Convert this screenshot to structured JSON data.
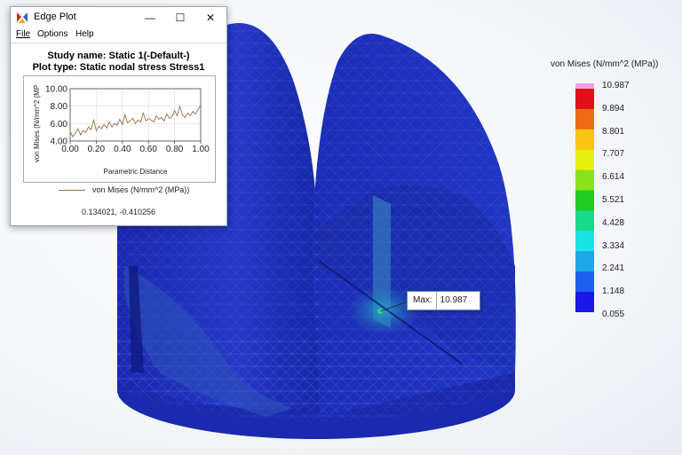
{
  "window": {
    "title": "Edge Plot",
    "minimize_glyph": "—",
    "maximize_glyph": "☐",
    "close_glyph": "✕",
    "icon": "solidworks-app-icon"
  },
  "menu": [
    {
      "label": "File"
    },
    {
      "label": "Options"
    },
    {
      "label": "Help"
    }
  ],
  "plot": {
    "study_name": "Study name: Static 1(-Default-)",
    "plot_type": "Plot type: Static nodal stress Stress1",
    "legend_label": "von Mises (N/mm^2 (MPa))",
    "coordinates": "0.134021, -0.410256",
    "line_color": "#9a6f4a"
  },
  "chart_data": {
    "type": "line",
    "xlabel": "Parametric Distance",
    "ylabel": "von Mises (N/mm^2 (MP",
    "xlim": [
      0.0,
      1.0
    ],
    "ylim": [
      4.0,
      10.0
    ],
    "xticks": [
      "0.00",
      "0.20",
      "0.40",
      "0.60",
      "0.80",
      "1.00"
    ],
    "yticks": [
      "4.00",
      "6.00",
      "8.00",
      "10.00"
    ],
    "grid": true,
    "series": [
      {
        "name": "von Mises (N/mm^2 (MPa))",
        "x": [
          0.0,
          0.02,
          0.04,
          0.06,
          0.08,
          0.1,
          0.12,
          0.14,
          0.16,
          0.18,
          0.2,
          0.22,
          0.24,
          0.26,
          0.28,
          0.3,
          0.32,
          0.34,
          0.36,
          0.38,
          0.4,
          0.42,
          0.44,
          0.46,
          0.48,
          0.5,
          0.52,
          0.54,
          0.56,
          0.58,
          0.6,
          0.62,
          0.64,
          0.66,
          0.68,
          0.7,
          0.72,
          0.74,
          0.76,
          0.78,
          0.8,
          0.82,
          0.84,
          0.86,
          0.88,
          0.9,
          0.92,
          0.94,
          0.96,
          0.98,
          1.0
        ],
        "values": [
          5.1,
          4.5,
          4.9,
          5.4,
          4.7,
          5.2,
          5.0,
          5.6,
          5.3,
          6.4,
          5.2,
          5.7,
          5.4,
          5.9,
          5.5,
          6.2,
          5.6,
          6.0,
          5.8,
          6.5,
          5.9,
          7.0,
          6.1,
          6.3,
          6.6,
          6.0,
          6.4,
          6.2,
          7.2,
          6.3,
          6.6,
          6.4,
          6.2,
          6.9,
          6.5,
          6.7,
          6.3,
          7.1,
          6.6,
          6.8,
          7.5,
          6.9,
          8.0,
          7.0,
          6.7,
          7.2,
          6.9,
          7.4,
          7.1,
          7.6,
          8.1
        ]
      }
    ]
  },
  "legend": {
    "title": "von Mises (N/mm^2 (MPa))",
    "labels": [
      "10.987",
      "9.894",
      "8.801",
      "7.707",
      "6.614",
      "5.521",
      "4.428",
      "3.334",
      "2.241",
      "1.148",
      "0.055"
    ],
    "colors": [
      "#e0101a",
      "#ef6a12",
      "#f7c514",
      "#e5f00d",
      "#8be21c",
      "#20cc24",
      "#18d98a",
      "#19e4e4",
      "#1aa8e8",
      "#1a5ff0",
      "#1a18e6"
    ],
    "top_color": "#f2a0ea"
  },
  "max_marker": {
    "label": "Max:",
    "value": "10.987"
  },
  "model": {
    "base_color": "#1f2fb8",
    "dark_color": "#0e1a8c",
    "stress_color": "#1f7aa8"
  }
}
